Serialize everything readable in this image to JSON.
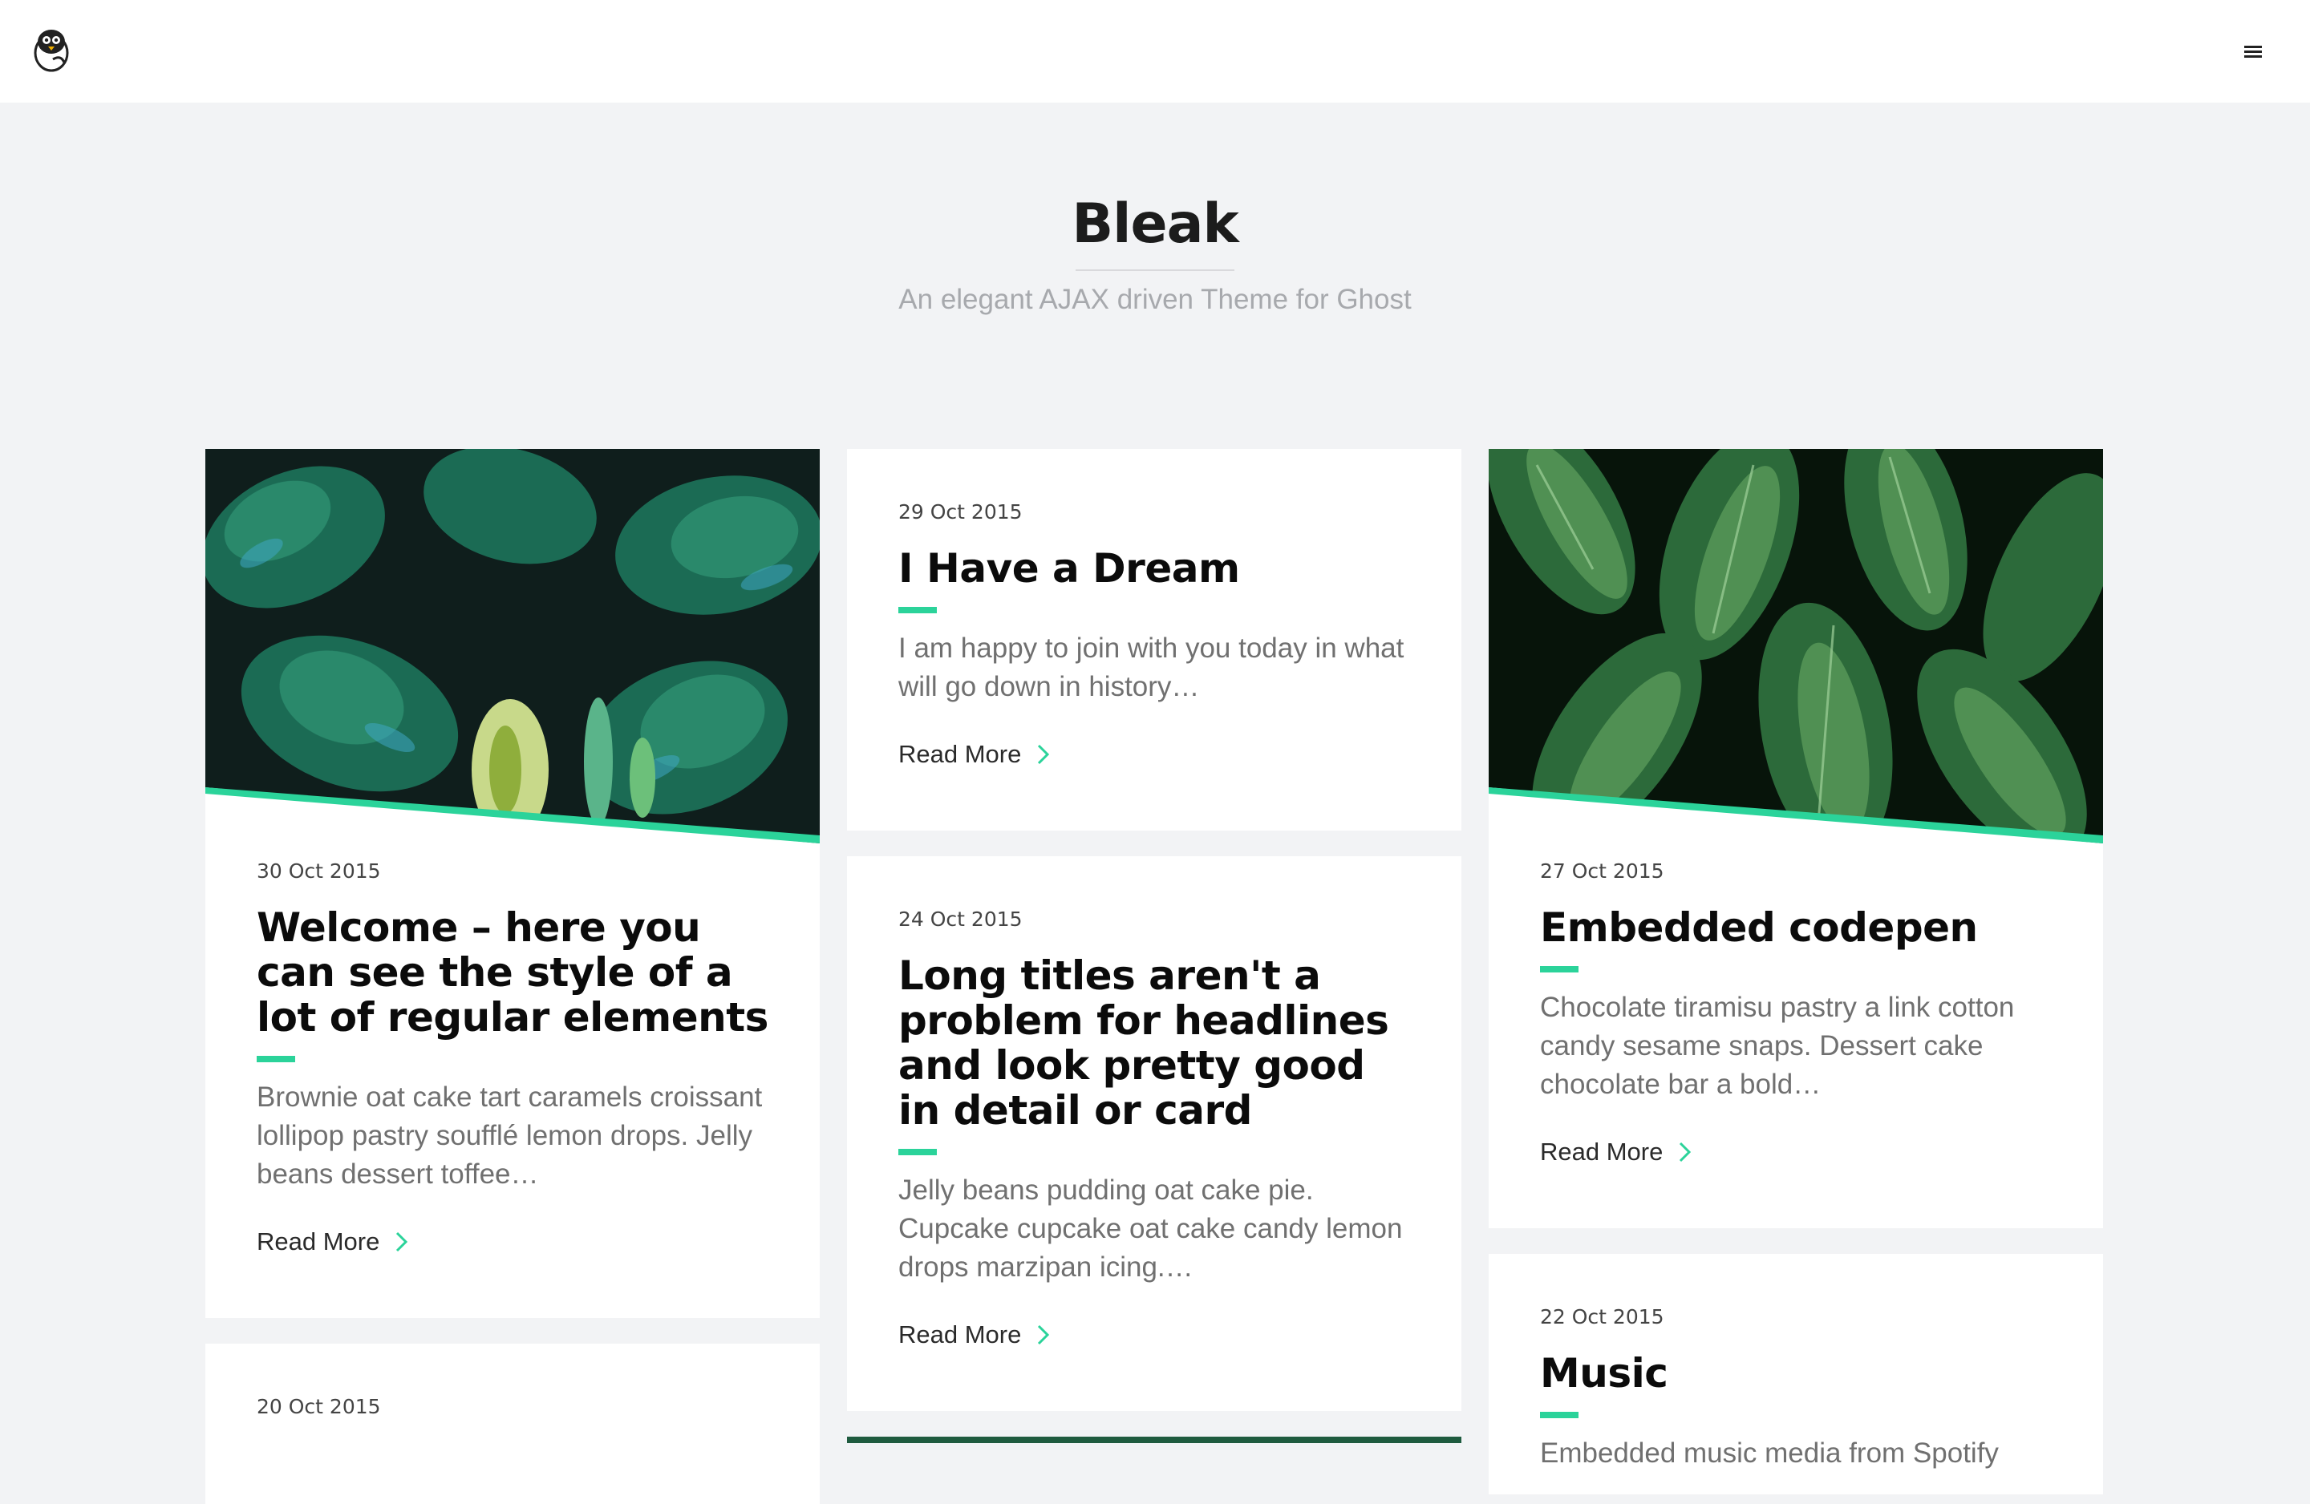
{
  "header": {
    "logo": "penguin-logo",
    "menu_icon": "hamburger-icon"
  },
  "site": {
    "title": "Bleak",
    "description": "An elegant AJAX driven Theme for Ghost"
  },
  "accent_color": "#2bd39a",
  "posts": [
    {
      "date": "30 Oct 2015",
      "title": "Welcome – here you can see the style of a lot of regular elements",
      "excerpt": "Brownie oat cake tart caramels croissant lollipop pastry soufflé lemon drops. Jelly beans dessert toffee…",
      "read_more": "Read More",
      "image": "monstera-leaves-illustration"
    },
    {
      "date": "29 Oct 2015",
      "title": "I Have a Dream",
      "excerpt": "I am happy to join with you today in what will go down in history…",
      "read_more": "Read More"
    },
    {
      "date": "27 Oct 2015",
      "title": "Embedded codepen",
      "excerpt": "Chocolate tiramisu pastry a link cotton candy sesame snaps. Dessert cake chocolate bar a bold…",
      "read_more": "Read More",
      "image": "green-leaves-watercolor"
    },
    {
      "date": "24 Oct 2015",
      "title": "Long titles aren't a problem for headlines and look pretty good in detail or card",
      "excerpt": "Jelly beans pudding oat cake pie. Cupcake cupcake oat cake candy lemon drops marzipan icing.…",
      "read_more": "Read More"
    },
    {
      "date": "22 Oct 2015",
      "title": "Music",
      "excerpt": "Embedded music media from Spotify"
    },
    {
      "date": "20 Oct 2015"
    }
  ]
}
